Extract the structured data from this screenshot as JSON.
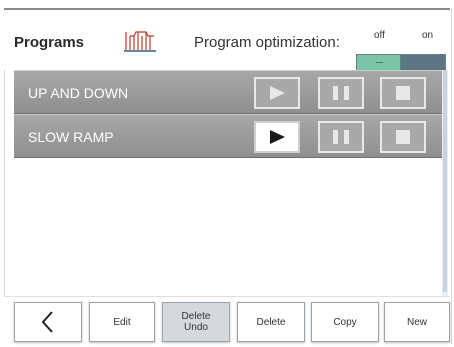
{
  "header": {
    "title": "Programs",
    "optimization_label": "Program optimization:",
    "toggle": {
      "off_label": "off",
      "on_label": "on",
      "state": "off"
    }
  },
  "programs": [
    {
      "name": "UP AND DOWN",
      "play_enabled": false
    },
    {
      "name": "SLOW RAMP",
      "play_enabled": true
    }
  ],
  "footer": {
    "back_icon": "chevron-left-icon",
    "edit": "Edit",
    "delete_undo_line1": "Delete",
    "delete_undo_line2": "Undo",
    "delete": "Delete",
    "copy": "Copy",
    "new": "New"
  },
  "colors": {
    "row_bg": "#9a9a9a",
    "toggle_knob": "#7cc4a8",
    "toggle_track": "#5c7583",
    "icon_red": "#c0392b"
  }
}
